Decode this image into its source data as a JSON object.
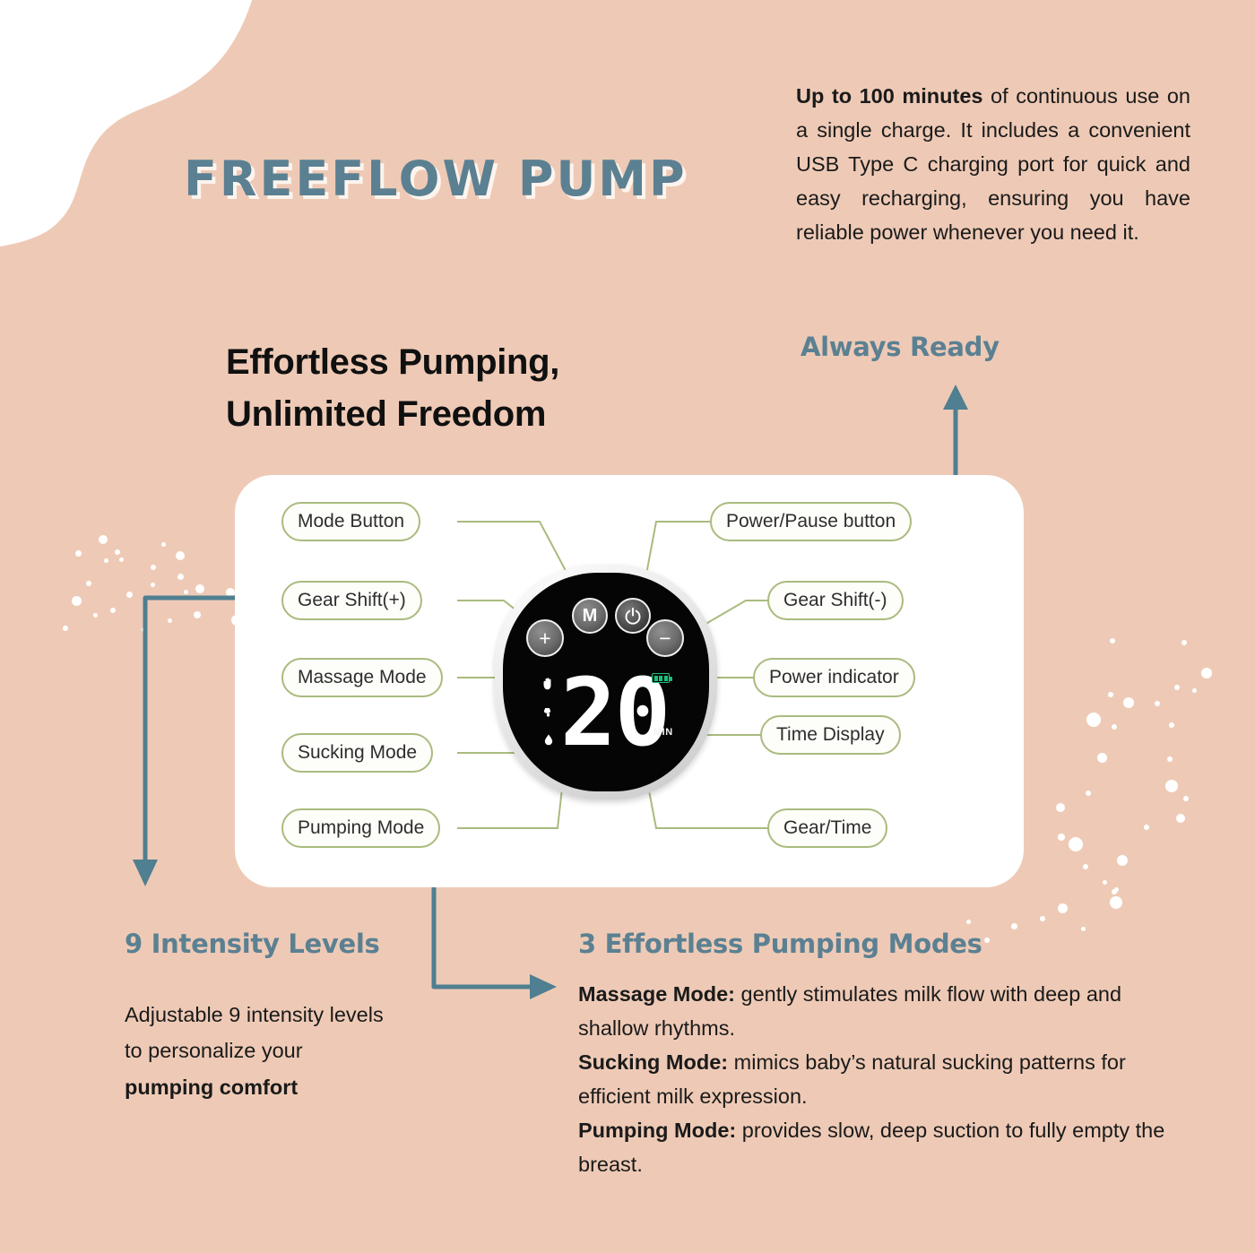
{
  "brand": {
    "title": "FREEFLOW PUMP"
  },
  "headline": {
    "line1": "Effortless Pumping,",
    "line2": "Unlimited Freedom"
  },
  "battery_block": {
    "bold_lead": "Up to 100 minutes",
    "rest": " of continuous use on a single charge. It includes a convenient USB Type C charging port for quick and easy recharging, ensuring you have reliable power whenever you need it.",
    "heading": "Always Ready"
  },
  "device": {
    "display_value": "20",
    "unit_label": "MIN",
    "buttons": {
      "plus": "+",
      "mode": "M",
      "power": "power-glyph",
      "minus": "−"
    },
    "battery_bars": 3,
    "mode_icons": [
      "hand-icon",
      "pump-icon",
      "droplet-icon"
    ]
  },
  "callouts": {
    "left": [
      {
        "label": "Mode Button"
      },
      {
        "label": "Gear Shift(+)"
      },
      {
        "label": "Massage Mode"
      },
      {
        "label": "Sucking Mode"
      },
      {
        "label": "Pumping Mode"
      }
    ],
    "right": [
      {
        "label": "Power/Pause button"
      },
      {
        "label": "Gear Shift(-)"
      },
      {
        "label": "Power indicator"
      },
      {
        "label": "Time Display"
      },
      {
        "label": "Gear/Time"
      }
    ]
  },
  "intensity": {
    "heading": "9 Intensity Levels",
    "body_normal_1": "Adjustable 9 intensity levels to personalize your ",
    "body_bold": "pumping comfort"
  },
  "modes": {
    "heading": "3 Effortless Pumping Modes",
    "items": [
      {
        "name": "Massage Mode:",
        "desc": " gently stimulates milk flow with deep and shallow rhythms."
      },
      {
        "name": "Sucking Mode:",
        "desc": " mimics baby’s natural sucking patterns for efficient milk expression."
      },
      {
        "name": "Pumping Mode:",
        "desc": " provides slow, deep suction to fully empty the breast."
      }
    ]
  },
  "colors": {
    "background_peach": "#eecab6",
    "accent_slate": "#5b8092",
    "pill_border_olive": "#a9bb7e",
    "battery_green": "#17c27a",
    "card_white": "#ffffff"
  }
}
